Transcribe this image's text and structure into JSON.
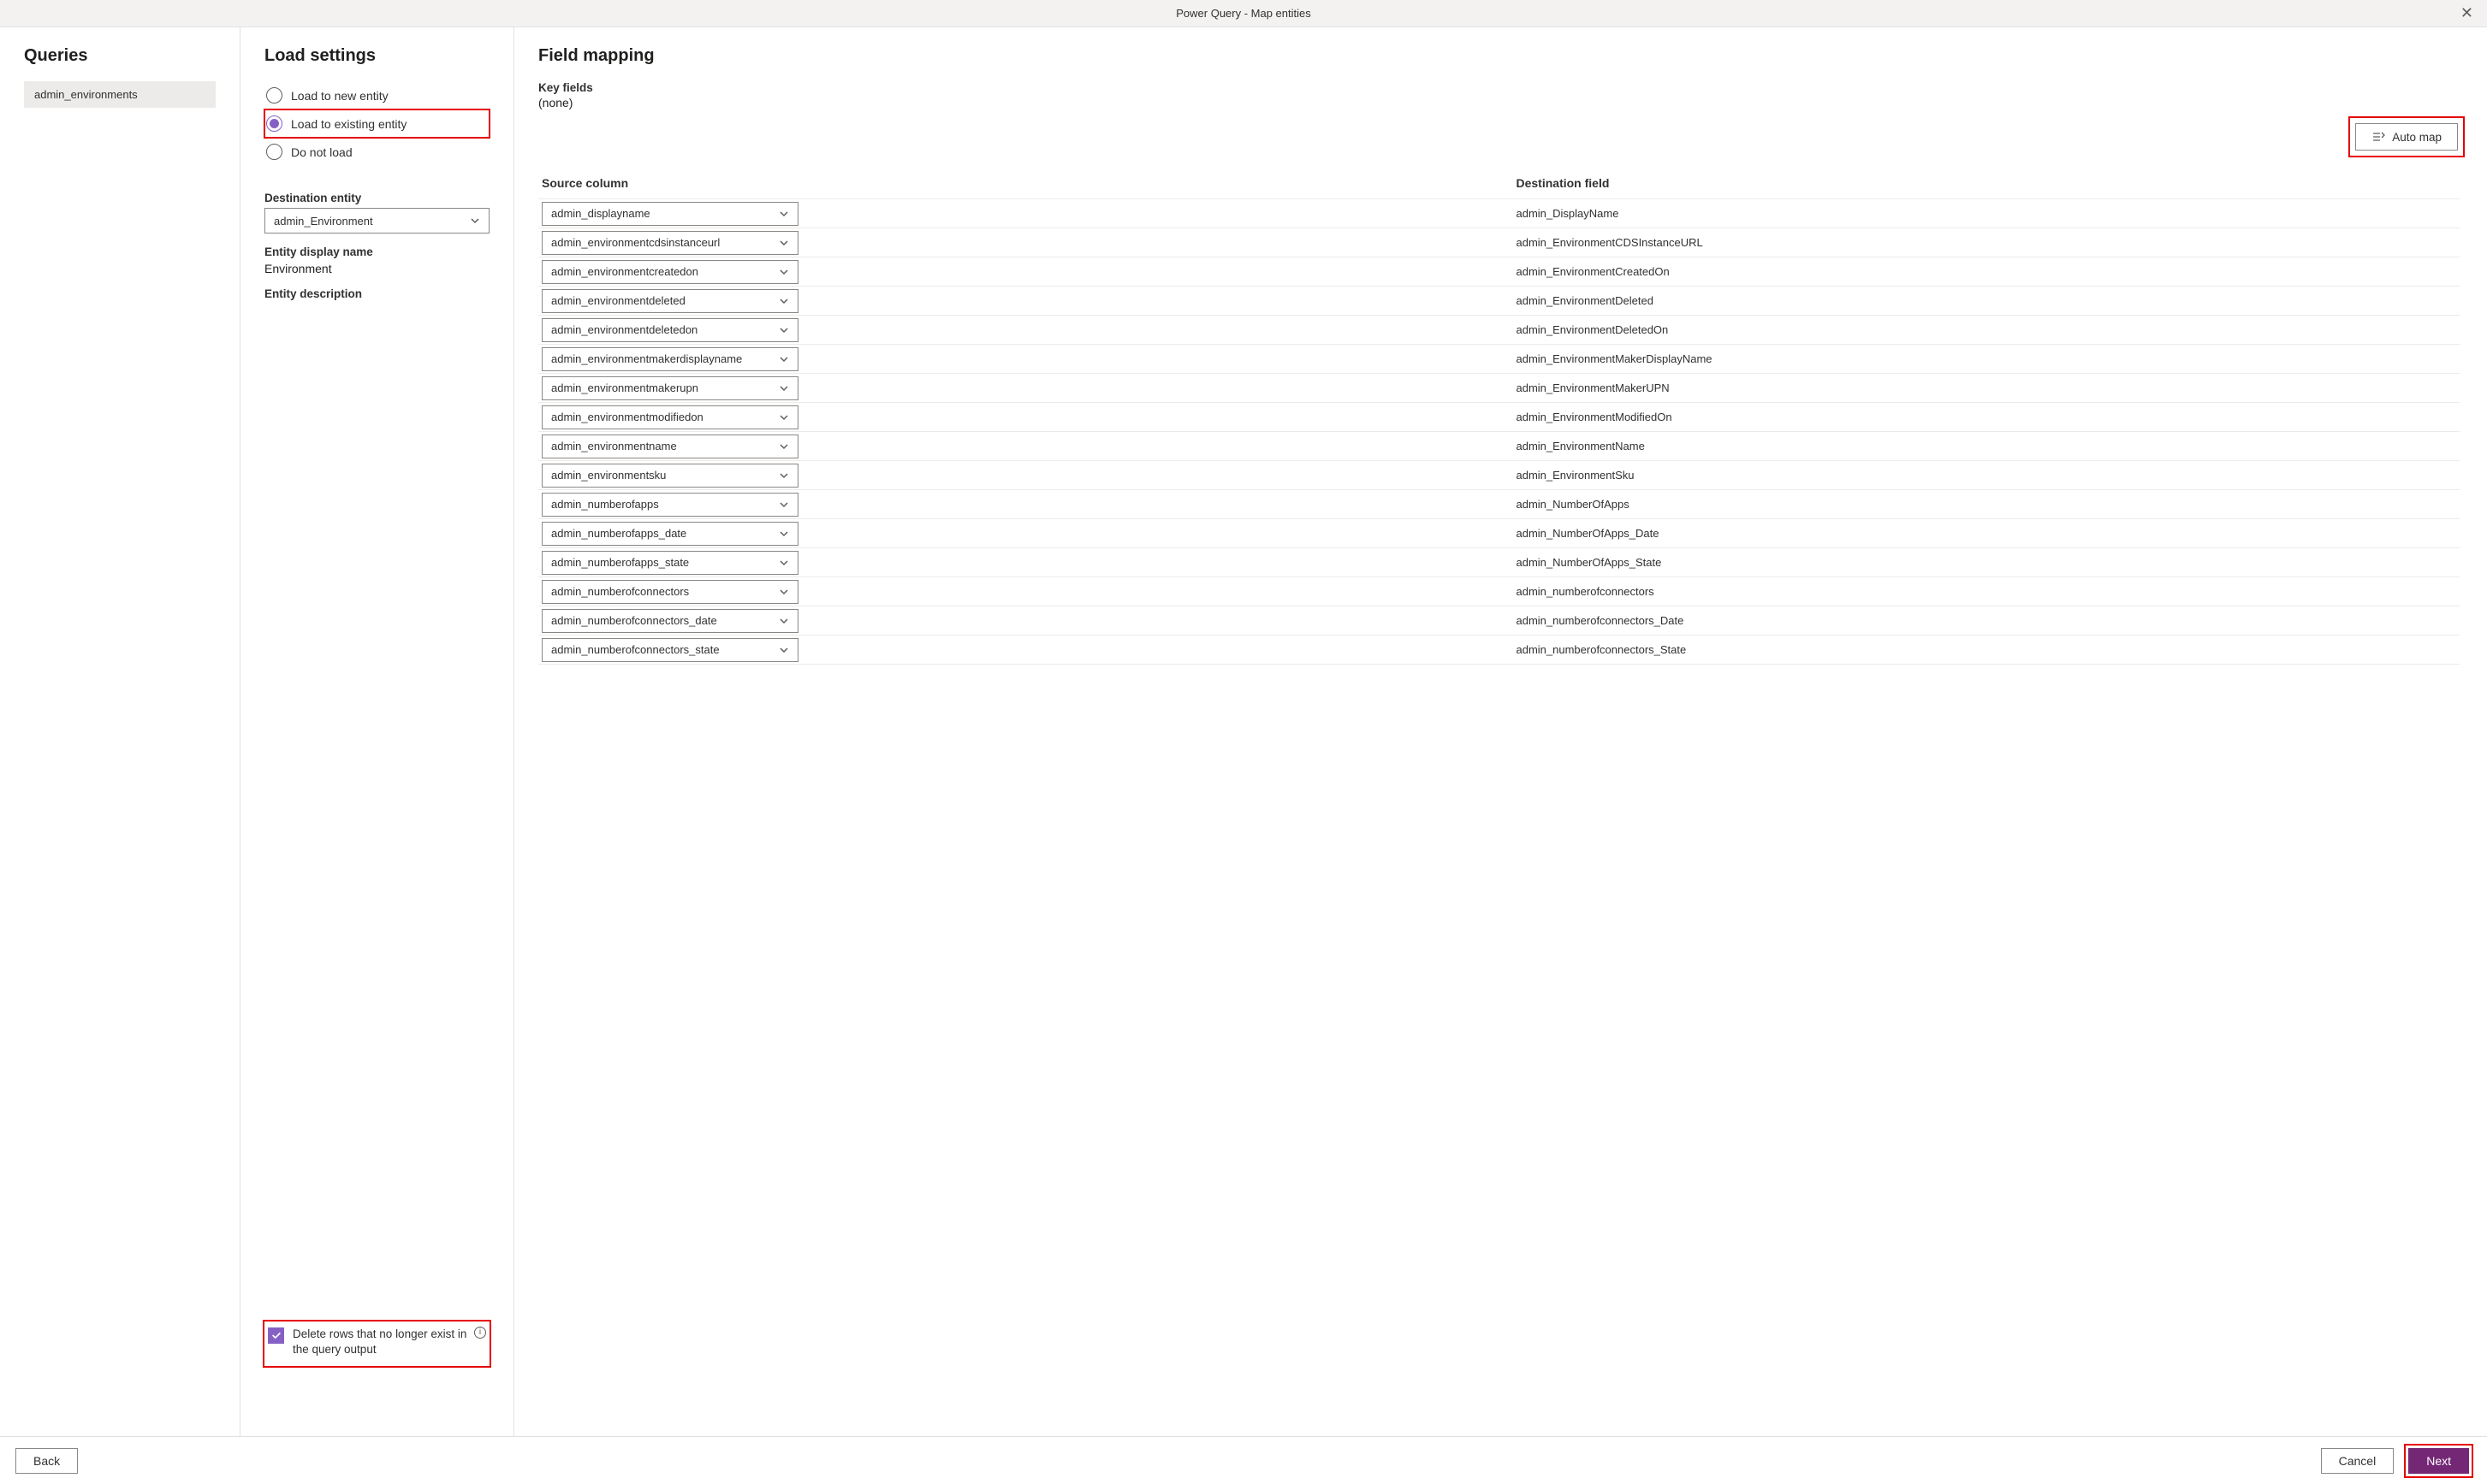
{
  "window": {
    "title": "Power Query - Map entities"
  },
  "queries": {
    "heading": "Queries",
    "items": [
      "admin_environments"
    ]
  },
  "load": {
    "heading": "Load settings",
    "opt_new": "Load to new entity",
    "opt_existing": "Load to existing entity",
    "opt_none": "Do not load",
    "dest_label": "Destination entity",
    "dest_value": "admin_Environment",
    "display_label": "Entity display name",
    "display_value": "Environment",
    "desc_label": "Entity description",
    "delete_label": "Delete rows that no longer exist in the query output"
  },
  "mapping": {
    "heading": "Field mapping",
    "key_label": "Key fields",
    "key_value": "(none)",
    "automap": "Auto map",
    "source_hdr": "Source column",
    "dest_hdr": "Destination field",
    "rows": [
      {
        "src": "admin_displayname",
        "dst": "admin_DisplayName"
      },
      {
        "src": "admin_environmentcdsinstanceurl",
        "dst": "admin_EnvironmentCDSInstanceURL"
      },
      {
        "src": "admin_environmentcreatedon",
        "dst": "admin_EnvironmentCreatedOn"
      },
      {
        "src": "admin_environmentdeleted",
        "dst": "admin_EnvironmentDeleted"
      },
      {
        "src": "admin_environmentdeletedon",
        "dst": "admin_EnvironmentDeletedOn"
      },
      {
        "src": "admin_environmentmakerdisplayname",
        "dst": "admin_EnvironmentMakerDisplayName"
      },
      {
        "src": "admin_environmentmakerupn",
        "dst": "admin_EnvironmentMakerUPN"
      },
      {
        "src": "admin_environmentmodifiedon",
        "dst": "admin_EnvironmentModifiedOn"
      },
      {
        "src": "admin_environmentname",
        "dst": "admin_EnvironmentName"
      },
      {
        "src": "admin_environmentsku",
        "dst": "admin_EnvironmentSku"
      },
      {
        "src": "admin_numberofapps",
        "dst": "admin_NumberOfApps"
      },
      {
        "src": "admin_numberofapps_date",
        "dst": "admin_NumberOfApps_Date"
      },
      {
        "src": "admin_numberofapps_state",
        "dst": "admin_NumberOfApps_State"
      },
      {
        "src": "admin_numberofconnectors",
        "dst": "admin_numberofconnectors"
      },
      {
        "src": "admin_numberofconnectors_date",
        "dst": "admin_numberofconnectors_Date"
      },
      {
        "src": "admin_numberofconnectors_state",
        "dst": "admin_numberofconnectors_State"
      }
    ]
  },
  "footer": {
    "back": "Back",
    "cancel": "Cancel",
    "next": "Next"
  }
}
